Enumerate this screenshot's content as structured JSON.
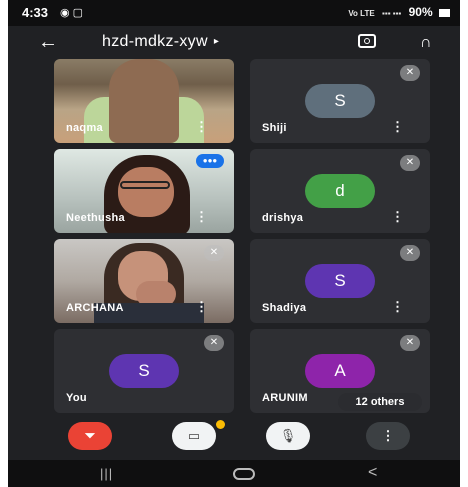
{
  "status_bar": {
    "time": "4:33",
    "left_icons": "◉ ▢",
    "network": "Vo LTE",
    "signal": "▪▪▪ ▪▪▪",
    "battery": "90%"
  },
  "top_bar": {
    "meeting_code": "hzd-mdkz-xyw",
    "caret": "▸"
  },
  "participants": [
    {
      "name": "naqma",
      "video": true
    },
    {
      "name": "Shiji",
      "initial": "S",
      "color": "#5f6f7c",
      "muted": true
    },
    {
      "name": "Neethusha",
      "video": true,
      "speaking": true
    },
    {
      "name": "drishya",
      "initial": "d",
      "color": "#43a047",
      "muted": true
    },
    {
      "name": "ARCHANA",
      "video": true,
      "muted": true
    },
    {
      "name": "Shadiya",
      "initial": "S",
      "color": "#5e35b1",
      "muted": true
    },
    {
      "name": "You",
      "initial": "S",
      "color": "#5e35b1",
      "muted": true
    },
    {
      "name": "ARUNIM",
      "initial": "A",
      "color": "#8e24aa",
      "muted": true
    }
  ],
  "others_pill": "12 others",
  "controls": {
    "end_call": "⏷",
    "camera": "▭",
    "mic": "🎙",
    "more": "⋮"
  },
  "nav": {
    "recents": "|||",
    "back": "<"
  }
}
